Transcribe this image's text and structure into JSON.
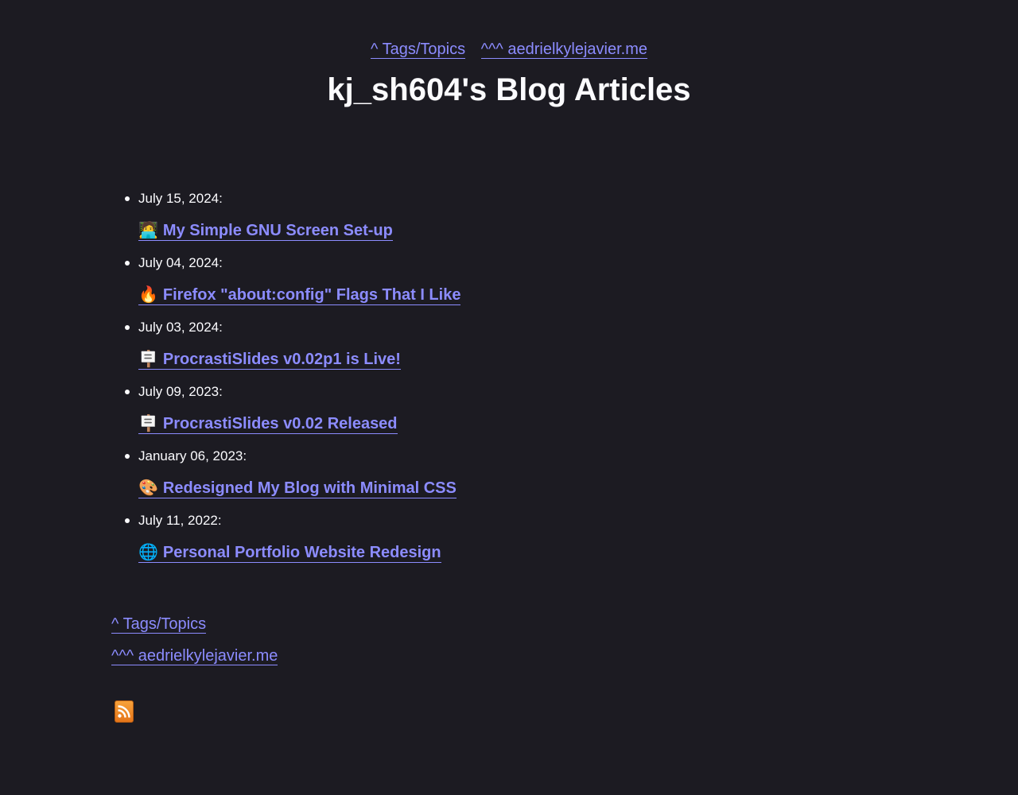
{
  "nav": {
    "tags_label": "^ Tags/Topics",
    "home_label": "^^^ aedrielkylejavier.me"
  },
  "page_title": "kj_sh604's Blog Articles",
  "articles": [
    {
      "date": "July 15, 2024",
      "emoji": "🧑‍💻",
      "title": "My Simple GNU Screen Set-up"
    },
    {
      "date": "July 04, 2024",
      "emoji": "🔥",
      "title": "Firefox \"about:config\" Flags That I Like"
    },
    {
      "date": "July 03, 2024",
      "emoji": "🪧",
      "title": "ProcrastiSlides v0.02p1 is Live!"
    },
    {
      "date": "July 09, 2023",
      "emoji": "🪧",
      "title": "ProcrastiSlides v0.02 Released"
    },
    {
      "date": "January 06, 2023",
      "emoji": "🎨",
      "title": "Redesigned My Blog with Minimal CSS"
    },
    {
      "date": "July 11, 2022",
      "emoji": "🌐",
      "title": "Personal Portfolio Website Redesign"
    }
  ],
  "footer": {
    "tags_label": "^ Tags/Topics",
    "home_label": "^^^ aedrielkylejavier.me",
    "rss_icon": "rss-feed-icon"
  },
  "colors": {
    "background": "#1c1b22",
    "link": "#8c8cff",
    "text": "#fbfbfe"
  }
}
